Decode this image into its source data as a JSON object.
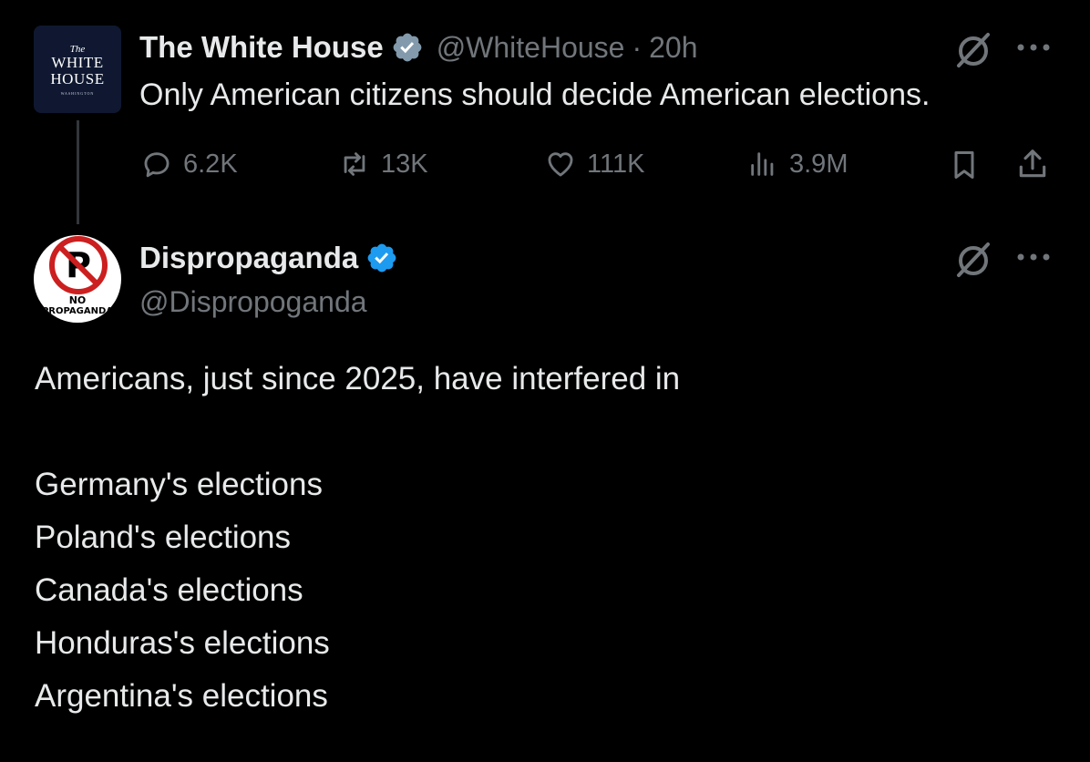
{
  "tweets": [
    {
      "avatar": {
        "small_top": "The",
        "main_line1": "WHITE",
        "main_line2": "HOUSE",
        "small_bottom": "WASHINGTON"
      },
      "name": "The White House",
      "handle": "@WhiteHouse",
      "separator": "·",
      "time": "20h",
      "text": "Only American citizens should decide American elections.",
      "actions": {
        "replies": "6.2K",
        "reposts": "13K",
        "likes": "111K",
        "views": "3.9M"
      }
    },
    {
      "avatar": {
        "text_line1": "NO",
        "text_line2": "PROPAGANDA"
      },
      "name": "Dispropaganda",
      "handle": "@Dispropoganda",
      "body": [
        "Americans, just since 2025, have interfered in",
        "Germany's elections",
        "Poland's elections",
        "Canada's elections",
        "Honduras's elections",
        "Argentina's elections"
      ]
    }
  ],
  "icons": {
    "verified_gray": "verified-badge-gray",
    "verified_blue": "verified-badge-blue",
    "grok": "grok-icon",
    "more": "more-icon",
    "reply": "reply-icon",
    "repost": "repost-icon",
    "like": "like-icon",
    "views": "views-icon",
    "bookmark": "bookmark-icon",
    "share": "share-icon"
  },
  "colors": {
    "background": "#000000",
    "text_primary": "#e7e9ea",
    "text_secondary": "#71767b",
    "verified_blue": "#1d9bf0",
    "verified_gray": "#829aab",
    "thread_line": "#333639"
  }
}
